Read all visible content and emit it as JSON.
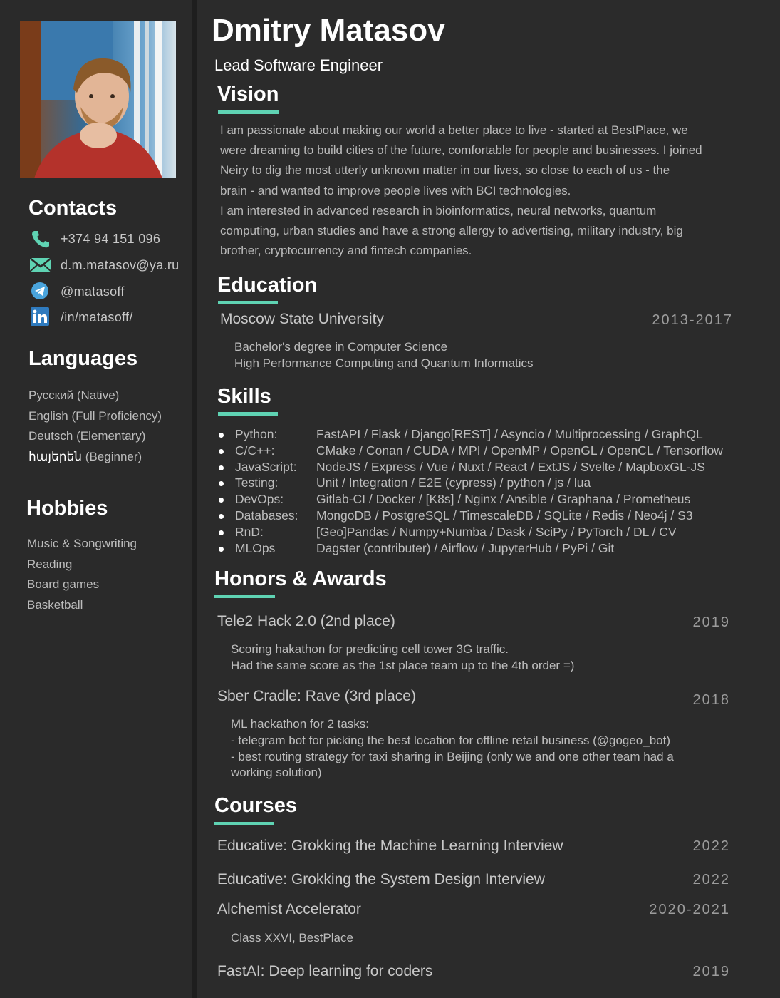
{
  "profile": {
    "name": "Dmitry Matasov",
    "role": "Lead Software Engineer"
  },
  "sidebar": {
    "contacts_heading": "Contacts",
    "contacts": [
      {
        "icon": "phone-icon",
        "text": "+374 94 151 096"
      },
      {
        "icon": "email-icon",
        "text": "d.m.matasov@ya.ru"
      },
      {
        "icon": "telegram-icon",
        "text": "@matasoff"
      },
      {
        "icon": "linkedin-icon",
        "text": "/in/matasoff/"
      }
    ],
    "languages_heading": "Languages",
    "languages": [
      {
        "name": "Русский",
        "level": "(Native)"
      },
      {
        "name": "English",
        "level": "(Full Proficiency)"
      },
      {
        "name": "Deutsch",
        "level": "(Elementary)"
      },
      {
        "name": "հայերեն",
        "level": "(Beginner)"
      }
    ],
    "hobbies_heading": "Hobbies",
    "hobbies": [
      "Music & Songwriting",
      "Reading",
      "Board games",
      "Basketball"
    ]
  },
  "vision": {
    "heading": "Vision",
    "lines": [
      "I am passionate about making our world a better place to live - started at BestPlace, we",
      "were dreaming to build cities of the future, comfortable for people and businesses. I joined",
      "Neiry to dig the most utterly unknown matter in our lives, so close to each of us - the",
      "brain - and wanted to improve people lives with BCI technologies.",
      "I am interested in advanced research in bioinformatics, neural networks, quantum",
      "computing, urban studies and have a strong allergy to advertising, military industry, big",
      "brother, cryptocurrency and fintech companies."
    ]
  },
  "education": {
    "heading": "Education",
    "entries": [
      {
        "title": "Moscow State University",
        "year": "2013-2017",
        "details": [
          "Bachelor's degree in Computer Science",
          "High Performance Computing and Quantum Informatics"
        ]
      }
    ]
  },
  "skills": {
    "heading": "Skills",
    "items": [
      {
        "name": "Python:",
        "value": "FastAPI / Flask / Django[REST] / Asyncio / Multiprocessing / GraphQL"
      },
      {
        "name": "C/C++:",
        "value": "CMake / Conan / CUDA / MPI / OpenMP / OpenGL / OpenCL / Tensorflow"
      },
      {
        "name": "JavaScript:",
        "value": "NodeJS / Express / Vue / Nuxt / React / ExtJS / Svelte / MapboxGL-JS"
      },
      {
        "name": "Testing:",
        "value": "Unit / Integration / E2E (cypress) / python / js / lua"
      },
      {
        "name": "DevOps:",
        "value": "Gitlab-CI / Docker / [K8s] / Nginx / Ansible / Graphana / Prometheus"
      },
      {
        "name": "Databases:",
        "value": "MongoDB / PostgreSQL / TimescaleDB / SQLite / Redis / Neo4j / S3"
      },
      {
        "name": "RnD:",
        "value": "[Geo]Pandas / Numpy+Numba / Dask / SciPy / PyTorch / DL / CV"
      },
      {
        "name": "MLOps",
        "value": "Dagster (contributer) / Airflow / JupyterHub / PyPi / Git"
      }
    ]
  },
  "awards": {
    "heading": "Honors & Awards",
    "entries": [
      {
        "title": "Tele2 Hack 2.0 (2nd place)",
        "year": "2019",
        "details": [
          "Scoring hakathon for predicting cell tower 3G traffic.",
          "Had the same score as the 1st place team up to the 4th order =)"
        ]
      },
      {
        "title": "Sber Cradle: Rave (3rd place)",
        "year": "2018",
        "details": [
          "ML hackathon for 2 tasks:",
          "- telegram bot for picking the best location for offline retail business (@gogeo_bot)",
          "- best routing strategy for taxi sharing in Beijing (only we and one other team had a",
          "working solution)"
        ]
      }
    ]
  },
  "courses": {
    "heading": "Courses",
    "entries": [
      {
        "title": "Educative: Grokking the Machine Learning Interview",
        "year": "2022"
      },
      {
        "title": "Educative: Grokking the System Design Interview",
        "year": "2022"
      },
      {
        "title": "Alchemist Accelerator",
        "year": "2020-2021",
        "details": [
          "Class XXVI, BestPlace"
        ]
      },
      {
        "title": "FastAI: Deep learning for coders",
        "year": "2019"
      }
    ]
  },
  "colors": {
    "accent": "#5fd3b3",
    "background": "#2b2b2b",
    "heading": "#ffffff"
  }
}
